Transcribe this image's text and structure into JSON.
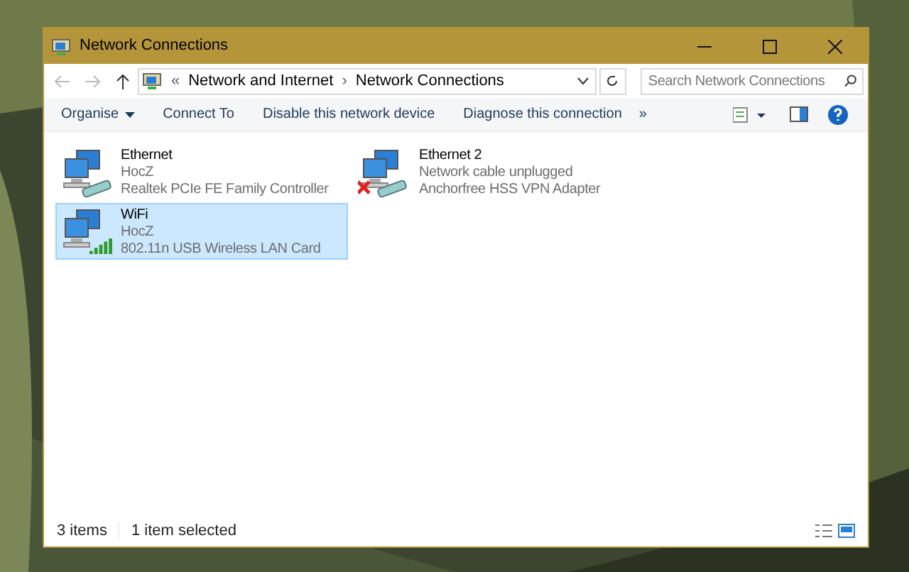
{
  "window": {
    "title": "Network Connections"
  },
  "address": {
    "breadcrumbs": [
      "Network and Internet",
      "Network Connections"
    ],
    "separator": "›",
    "prefix": "«"
  },
  "search": {
    "placeholder": "Search Network Connections"
  },
  "toolbar": [
    {
      "label": "Organise",
      "dropdown": true
    },
    {
      "label": "Connect To",
      "dropdown": false
    },
    {
      "label": "Disable this network device",
      "dropdown": false
    },
    {
      "label": "Diagnose this connection",
      "dropdown": false
    }
  ],
  "toolbar_more": "»",
  "connections": [
    {
      "name": "Ethernet",
      "status": "HocZ",
      "adapter": "Realtek PCIe FE Family Controller",
      "kind": "wired",
      "selected": false
    },
    {
      "name": "Ethernet 2",
      "status": "Network cable unplugged",
      "adapter": "Anchorfree HSS VPN Adapter",
      "kind": "unplugged",
      "selected": false
    },
    {
      "name": "WiFi",
      "status": "HocZ",
      "adapter": "802.11n USB Wireless LAN Card",
      "kind": "wireless",
      "selected": true
    }
  ],
  "status_bar": {
    "count": "3 items",
    "selection": "1 item selected"
  }
}
